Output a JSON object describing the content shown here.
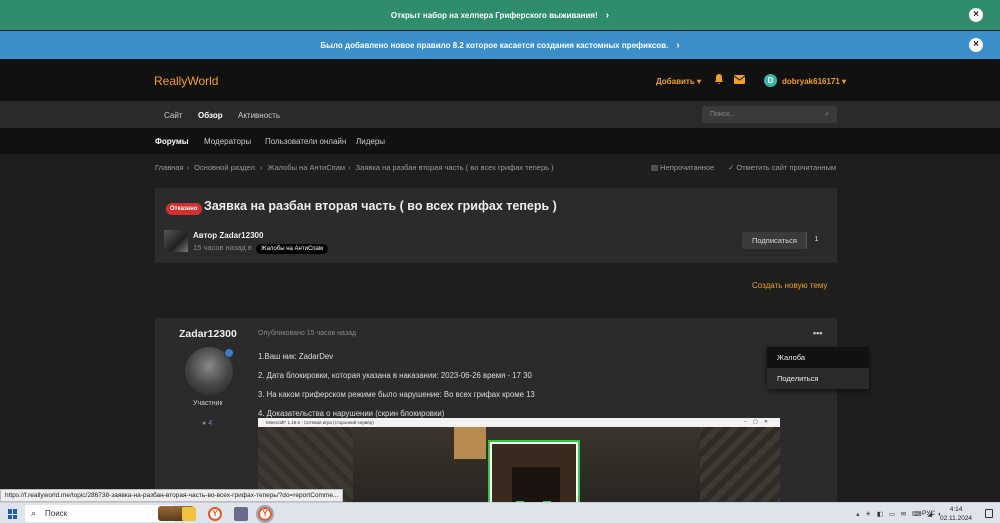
{
  "banners": [
    {
      "text": "Открыт набор на хелпера Гриферского выживания!",
      "color": "#2f8c6c"
    },
    {
      "text": "Было добавлено новое правило 8.2 которое касается создания кастомных префиксов.",
      "color": "#3b8ec8"
    }
  ],
  "header": {
    "logo": "ReallyWorld",
    "add_label": "Добавить ▾",
    "avatar_letter": "D",
    "username": "dobryak616171 ▾",
    "accent": "#f0a020"
  },
  "nav_primary": [
    "Сайт",
    "Обзор",
    "Активность"
  ],
  "search": {
    "placeholder": "Поиск..."
  },
  "nav_secondary": [
    "Форумы",
    "Модераторы",
    "Пользователи онлайн",
    "Лидеры"
  ],
  "breadcrumb": [
    "Главная",
    "Основной раздел.",
    "Жалобы на АнтиСпам",
    "Заявка на разбан вторая часть ( во всех грифах теперь )"
  ],
  "crumb_actions": {
    "unread": "Непрочитанное",
    "mark_read": "Отметить сайт прочитанным"
  },
  "topic": {
    "status_badge": "Отказано",
    "title": "Заявка на разбан вторая часть ( во всех грифах теперь )",
    "author_line": "Автор Zadar12300",
    "meta": "15 часов назад в",
    "forum_tag": "Жалобы на АнтиСпам",
    "subscribe_label": "Подписаться",
    "subscribe_count": "1"
  },
  "new_topic_label": "Создать новую тему",
  "post": {
    "author": "Zadar12300",
    "role": "Участник",
    "post_count": "4",
    "published": "Опубликовано 15 часов назад",
    "menu_dots": "•••",
    "lines": [
      "1.Ваш ник: ZadarDev",
      "2. Дата блокировки, которая указана в наказании: 2023-06-26 время - 17 30",
      "3. На каком гриферском режиме было нарушение: Во всех грифах кроме 13",
      "4. Доказательства о нарушении (скрин блокировки)"
    ],
    "screenshot_title": "Minecraft* 1.16.5 - Сетевая игра (сторонний сервер)"
  },
  "post_menu": [
    "Жалоба",
    "Поделиться"
  ],
  "status_url": "https://f.reallyworld.me/topic/286738-заявка-на-разбан-вторая-часть-во-всех-грифах-теперь/?do=reportComme...",
  "taskbar": {
    "search_label": "Поиск",
    "lang": "РУС",
    "time": "4:14",
    "date": "02.11.2024"
  },
  "icons": [
    "windows-icon",
    "search-icon",
    "file-explorer-icon",
    "yandex-browser-icon",
    "app-icon",
    "bell-icon",
    "mail-icon",
    "ellipsis-icon",
    "eye-icon",
    "check-icon",
    "comment-icon"
  ]
}
